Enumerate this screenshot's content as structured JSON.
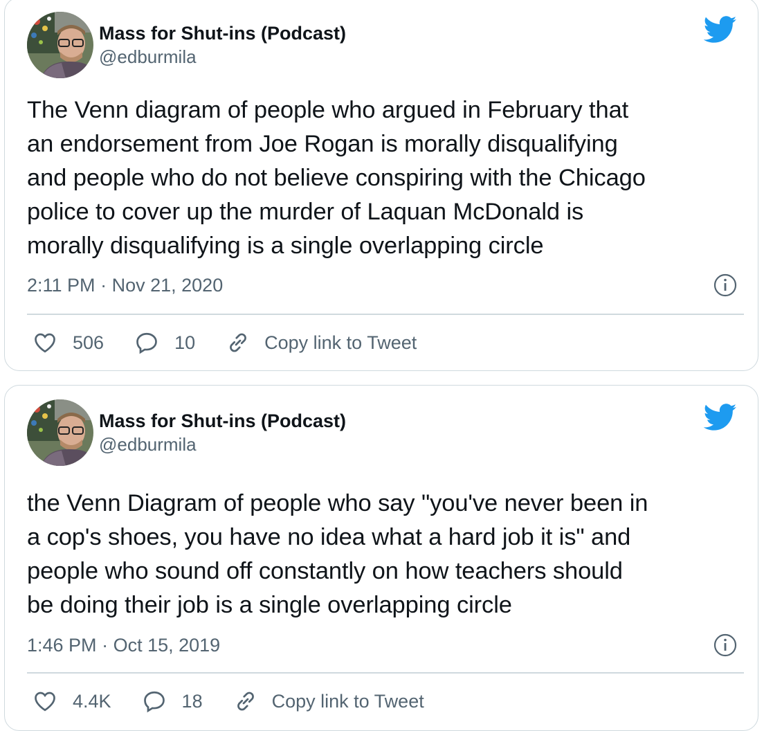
{
  "tweets": [
    {
      "display_name": "Mass for Shut-ins (Podcast)",
      "handle": "@edburmila",
      "text": "The Venn diagram of people who argued in February that\nan endorsement from Joe Rogan is morally disqualifying\nand people who do not believe conspiring with the Chicago\npolice to cover up the murder of Laquan McDonald is\nmorally disqualifying is a single overlapping circle",
      "time": "2:11 PM",
      "date": "Nov 21, 2020",
      "likes": "506",
      "replies": "10",
      "copy_link_label": "Copy link to Tweet"
    },
    {
      "display_name": "Mass for Shut-ins (Podcast)",
      "handle": "@edburmila",
      "text": "the Venn Diagram of people who say \"you've never been in\na cop's shoes, you have no idea what a hard job it is\" and\npeople who sound off constantly on how teachers should\nbe doing their job is a single overlapping circle",
      "time": "1:46 PM",
      "date": "Oct 15, 2019",
      "likes": "4.4K",
      "replies": "18",
      "copy_link_label": "Copy link to Tweet"
    }
  ],
  "meta_separator": "·",
  "icons": {
    "brand": "twitter-bird-icon",
    "info": "info-icon",
    "like": "heart-icon",
    "reply": "reply-bubble-icon",
    "link": "link-icon"
  },
  "colors": {
    "twitter_blue": "#1d9bf0",
    "secondary_text": "#536471",
    "border": "#cfd9de"
  }
}
